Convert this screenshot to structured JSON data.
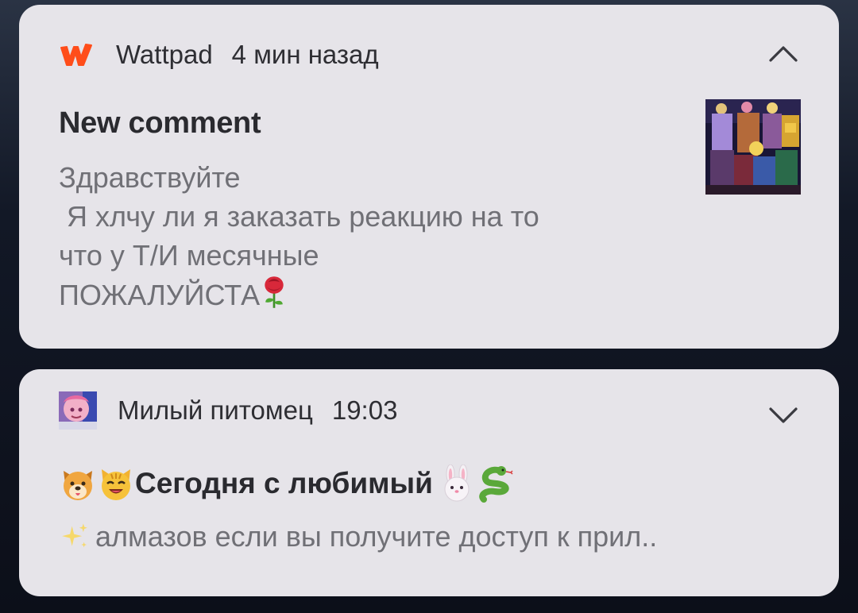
{
  "notifications": [
    {
      "app_name": "Wattpad",
      "app_icon": "wattpad-w-icon",
      "time": "4 мин назад",
      "expand_icon": "chevron-up-icon",
      "title": "New comment",
      "body_lines": [
        "Здравствуйте",
        " Я хлчу ли я заказать реакцию на то",
        "что у Т/И месячные",
        "ПОЖАЛУЙСТА"
      ],
      "body_trailing_icon": "rose-emoji",
      "thumbnail": "anime-characters-thumbnail",
      "accent": "#ff4d1a"
    },
    {
      "app_name": "Милый питомец",
      "app_icon": "anime-avatar-icon",
      "time": "19:03",
      "expand_icon": "chevron-down-icon",
      "title": "Сегодня с любимый",
      "title_leading_icons": [
        "dog-face-emoji",
        "cat-face-emoji"
      ],
      "title_trailing_icons": [
        "rabbit-face-emoji",
        "snake-emoji"
      ],
      "body": "алмазов если вы получите доступ к прил..",
      "body_leading_icon": "sparkles-emoji"
    }
  ]
}
